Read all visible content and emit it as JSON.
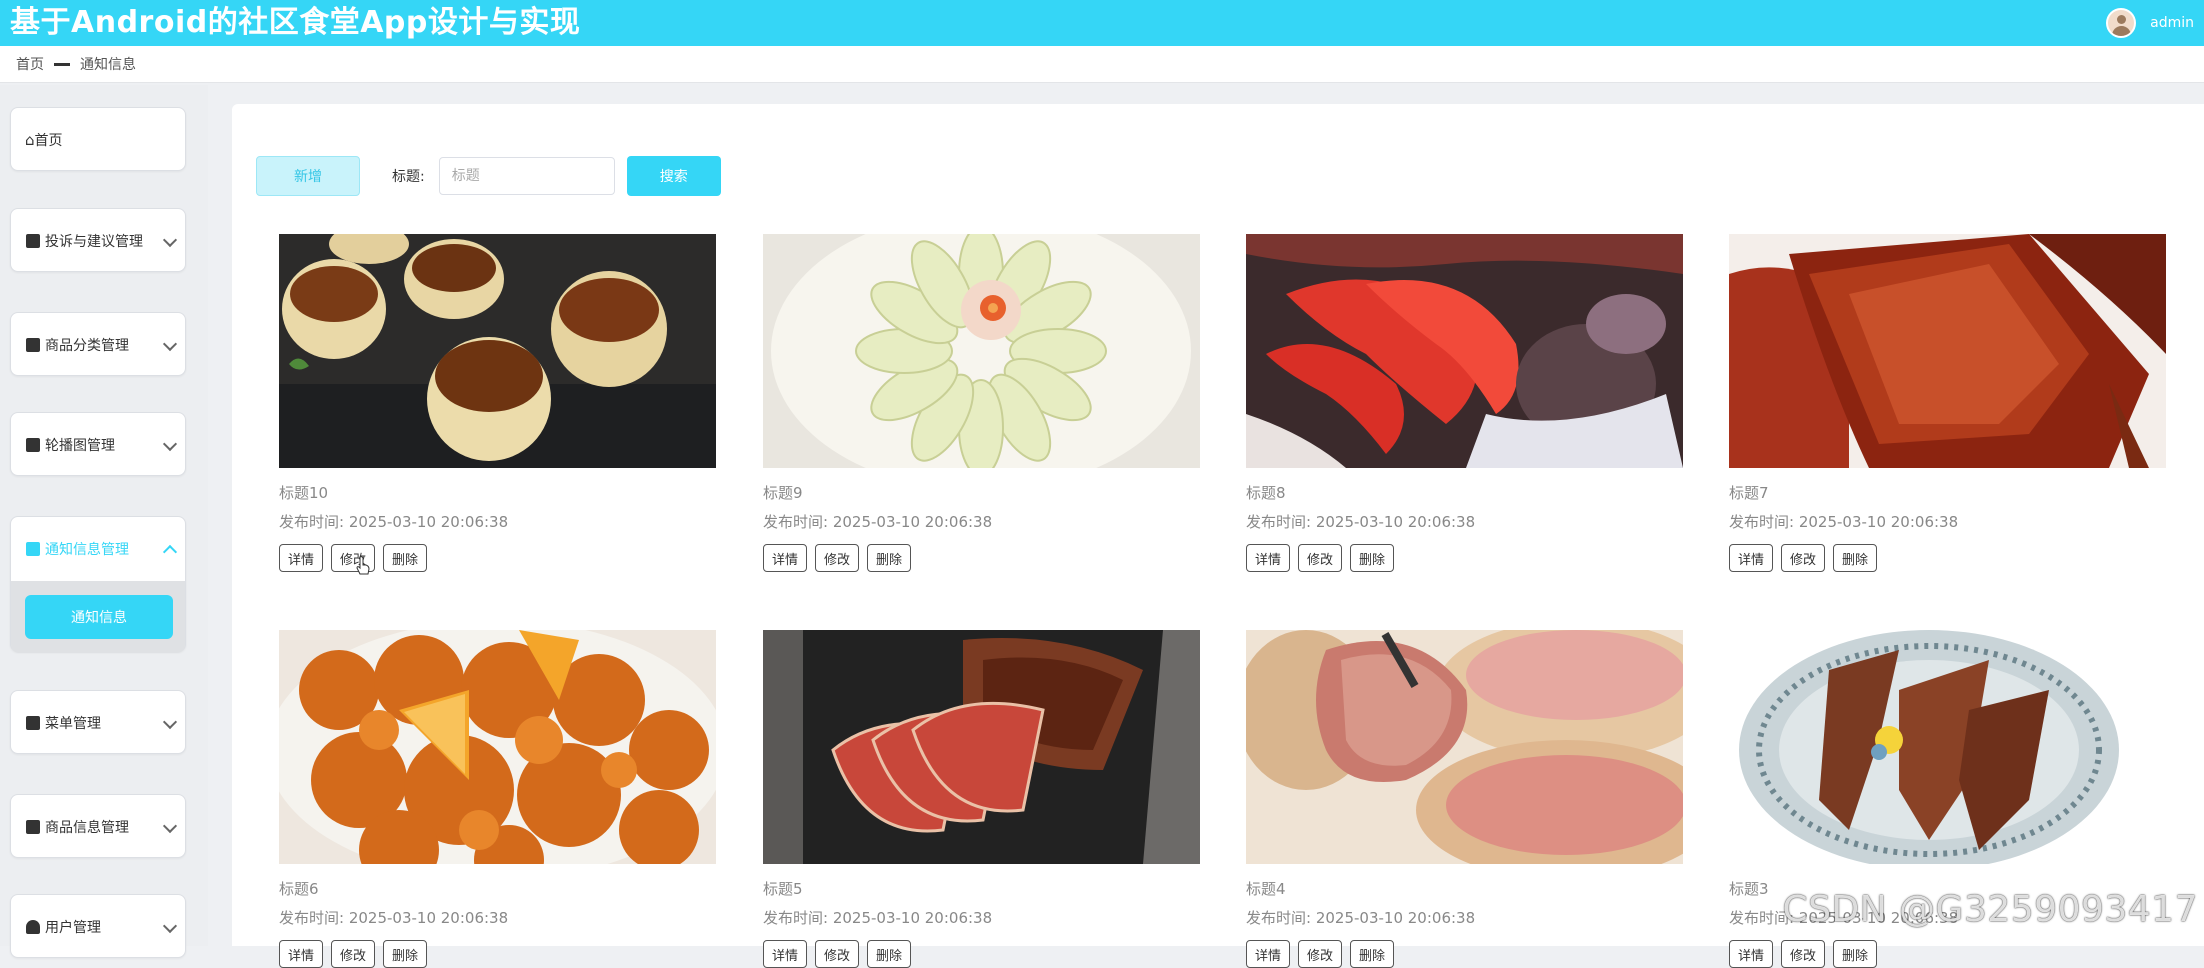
{
  "header": {
    "title": "基于Android的社区食堂App设计与实现",
    "username": "admin"
  },
  "breadcrumb": {
    "home": "首页",
    "current": "通知信息"
  },
  "sidebar": {
    "items": [
      {
        "label": "首页",
        "icon": "home-icon"
      },
      {
        "label": "投诉与建议管理",
        "icon": "list-icon"
      },
      {
        "label": "商品分类管理",
        "icon": "list-icon"
      },
      {
        "label": "轮播图管理",
        "icon": "list-icon"
      },
      {
        "label": "通知信息管理",
        "icon": "list-icon",
        "active": true,
        "expanded": true,
        "subitem": "通知信息"
      },
      {
        "label": "菜单管理",
        "icon": "list-icon"
      },
      {
        "label": "商品信息管理",
        "icon": "list-icon"
      },
      {
        "label": "用户管理",
        "icon": "user-icon"
      }
    ]
  },
  "toolbar": {
    "add_label": "新增",
    "title_label": "标题:",
    "title_placeholder": "标题",
    "search_label": "搜索"
  },
  "card_actions": {
    "detail": "详情",
    "edit": "修改",
    "delete": "删除"
  },
  "cards": [
    {
      "title": "标题10",
      "time": "发布时间: 2025-03-10 20:06:38",
      "image": "tartlets"
    },
    {
      "title": "标题9",
      "time": "发布时间: 2025-03-10 20:06:38",
      "image": "sliced-sausage"
    },
    {
      "title": "标题8",
      "time": "发布时间: 2025-03-10 20:06:38",
      "image": "seafood"
    },
    {
      "title": "标题7",
      "time": "发布时间: 2025-03-10 20:06:38",
      "image": "roast-pork"
    },
    {
      "title": "标题6",
      "time": "发布时间: 2025-03-10 20:06:38",
      "image": "orange-chicken"
    },
    {
      "title": "标题5",
      "time": "发布时间: 2025-03-10 20:06:38",
      "image": "smoked-ham"
    },
    {
      "title": "标题4",
      "time": "发布时间: 2025-03-10 20:06:38",
      "image": "sliced-ham"
    },
    {
      "title": "标题3",
      "time": "发布时间: 2025-03-10 20:06:38",
      "image": "braised-meat"
    }
  ],
  "watermark": "CSDN @G3259093417",
  "colors": {
    "accent": "#35d6f6",
    "sidebar_bg": "#eceef1"
  }
}
